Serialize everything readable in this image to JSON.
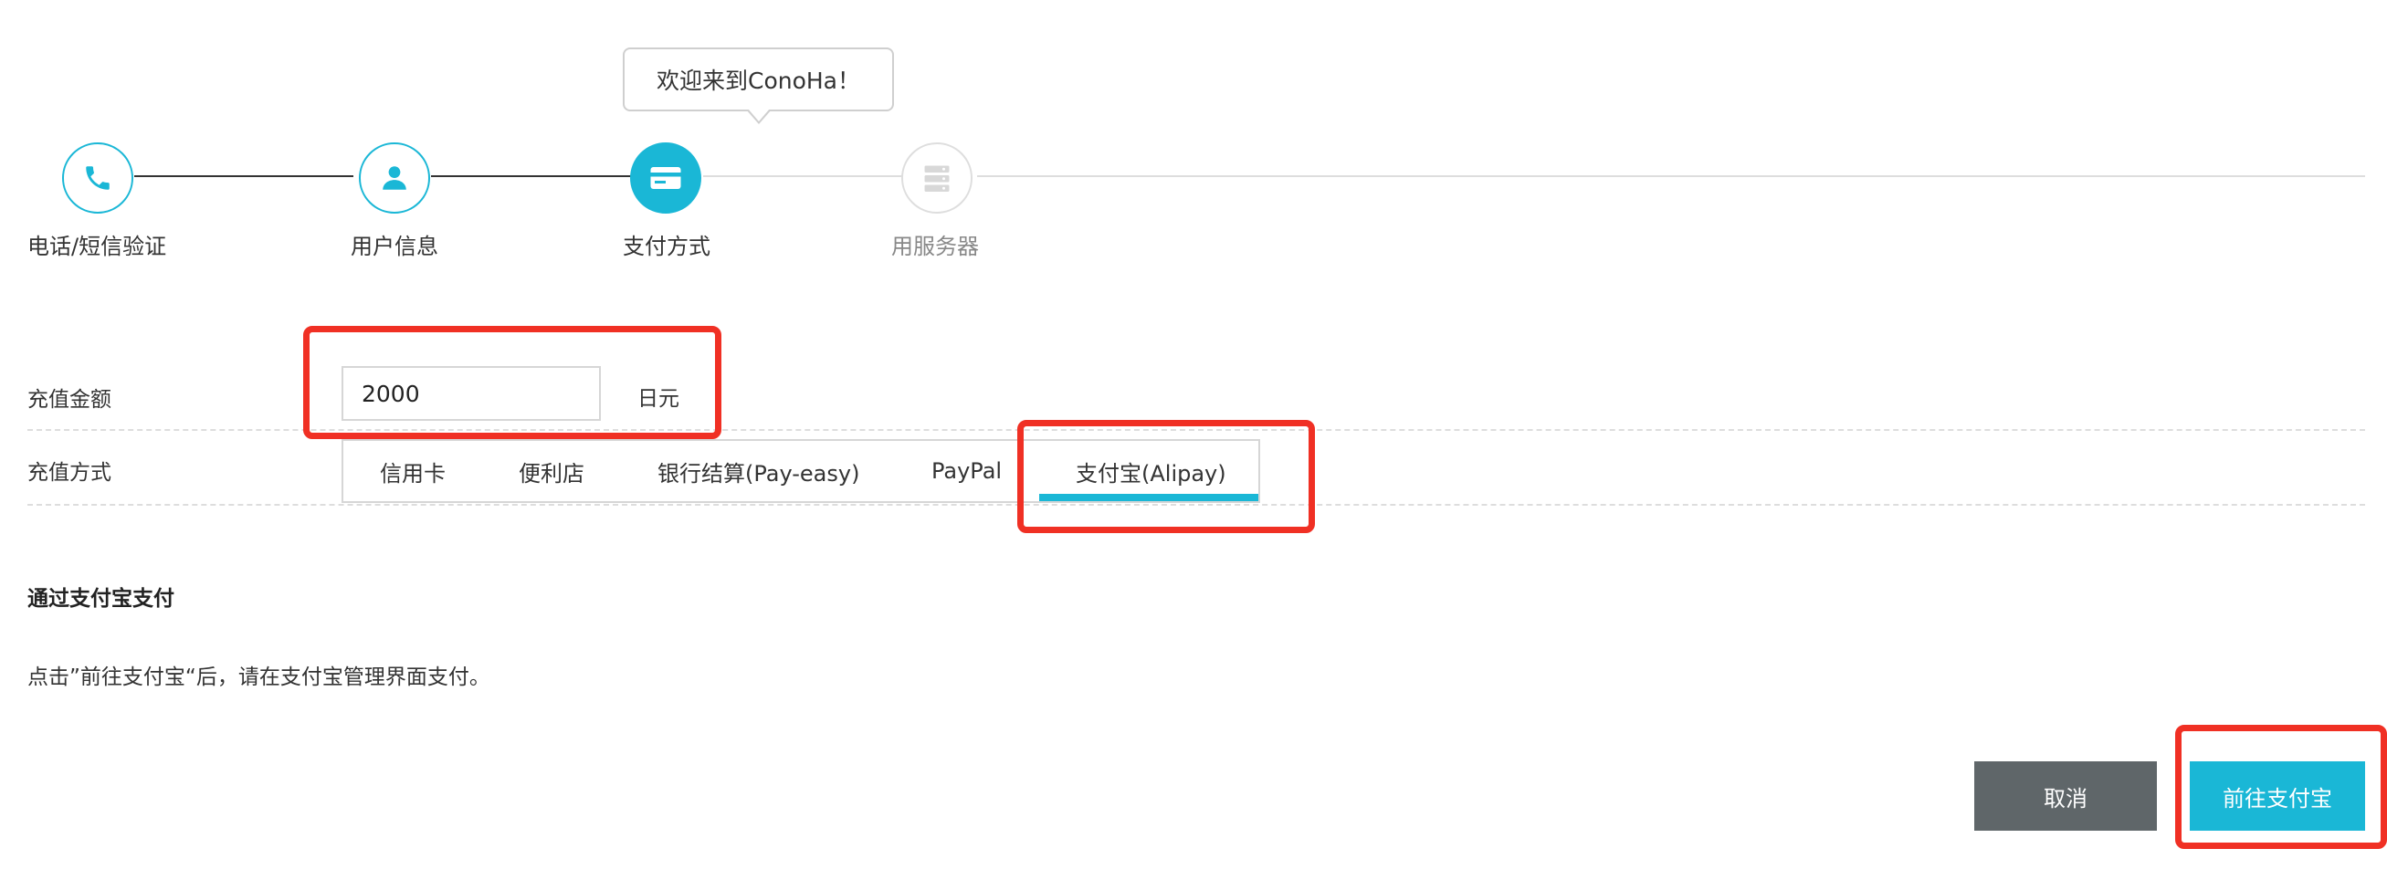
{
  "tooltip": {
    "text": "欢迎来到ConoHa！"
  },
  "steps": [
    {
      "label": "电话/短信验证",
      "icon": "phone-icon",
      "state": "done"
    },
    {
      "label": "用户信息",
      "icon": "user-icon",
      "state": "done"
    },
    {
      "label": "支付方式",
      "icon": "credit-card-icon",
      "state": "active"
    },
    {
      "label": "用服务器",
      "icon": "server-icon",
      "state": "todo"
    }
  ],
  "form": {
    "amount_label": "充值金额",
    "amount_value": "2000",
    "amount_unit": "日元",
    "method_label": "充值方式",
    "tabs": [
      {
        "label": "信用卡"
      },
      {
        "label": "便利店"
      },
      {
        "label": "银行结算(Pay-easy)"
      },
      {
        "label": "PayPal"
      },
      {
        "label": "支付宝(Alipay)"
      }
    ],
    "selected_tab": "支付宝(Alipay)"
  },
  "section": {
    "title": "通过支付宝支付",
    "description": "点击”前往支付宝“后，请在支付宝管理界面支付。"
  },
  "buttons": {
    "cancel": "取消",
    "go": "前往支付宝"
  },
  "colors": {
    "accent": "#1ab7d6",
    "highlight": "#f03024",
    "cancel_bg": "#5f6669"
  }
}
